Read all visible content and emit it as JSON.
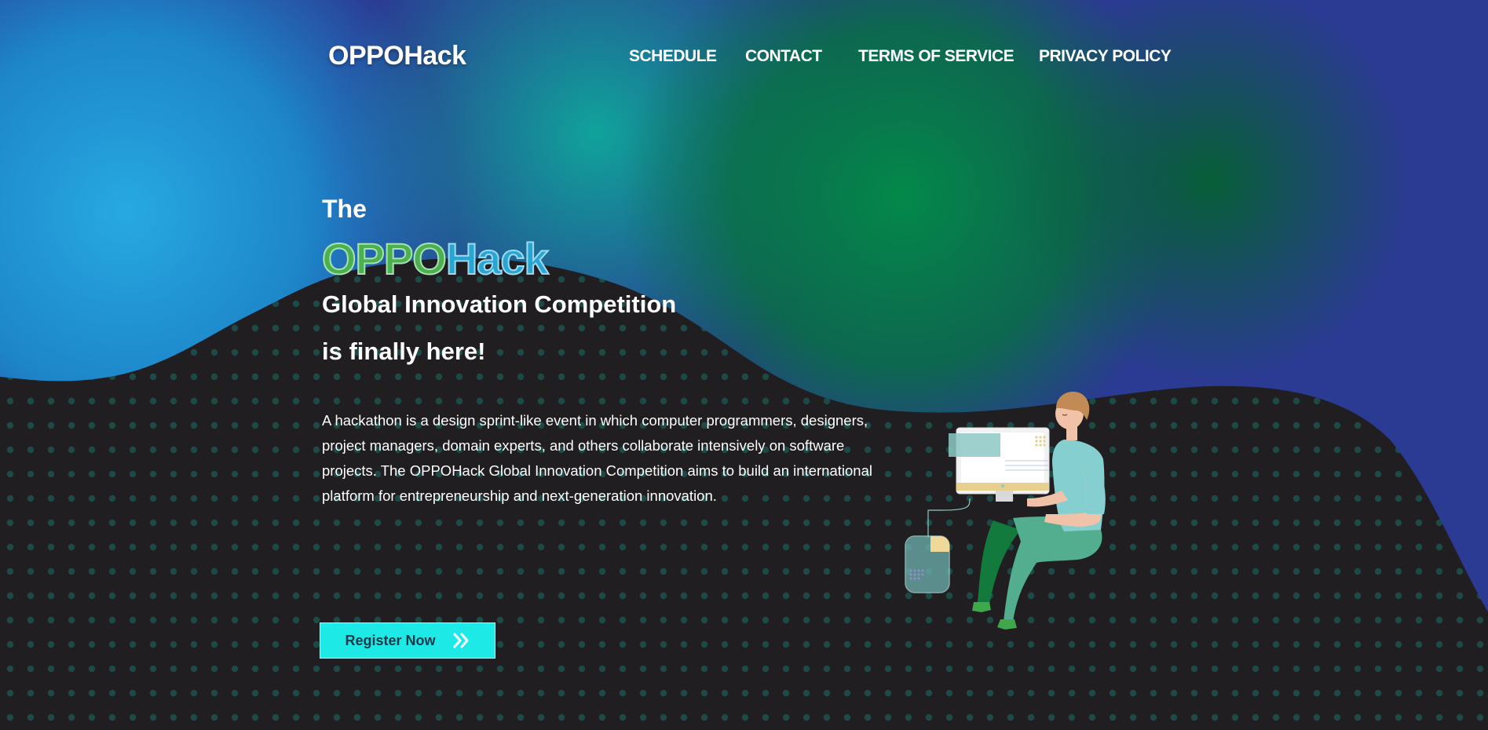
{
  "header": {
    "logo": "OPPOHack",
    "nav": [
      {
        "label": "SCHEDULE"
      },
      {
        "label": "CONTACT"
      },
      {
        "label": "TERMS OF SERVICE"
      },
      {
        "label": "PRIVACY POLICY"
      }
    ]
  },
  "hero": {
    "the": "The",
    "brand_part1": "OPPO",
    "brand_part2": "Hack",
    "line1": "Global Innovation Competition",
    "line2": "is finally here!",
    "description": "A hackathon is a design sprint-like event in which computer programmers, designers, project managers, domain experts, and others collaborate intensively on software projects. The OPPOHack Global Innovation Competition aims to build an international platform for entrepreneurship and next-generation innovation.",
    "register_label": "Register Now"
  },
  "icons": {
    "register": "double-chevron-right-icon",
    "illustration": "person-at-computer-illustration"
  },
  "colors": {
    "dark_background": "#211e21",
    "dot_color": "#1d4a47",
    "brand_green": "#4caf50",
    "brand_blue": "#27a6d4",
    "button_bg": "#1de9e6",
    "button_text": "#17394a"
  }
}
